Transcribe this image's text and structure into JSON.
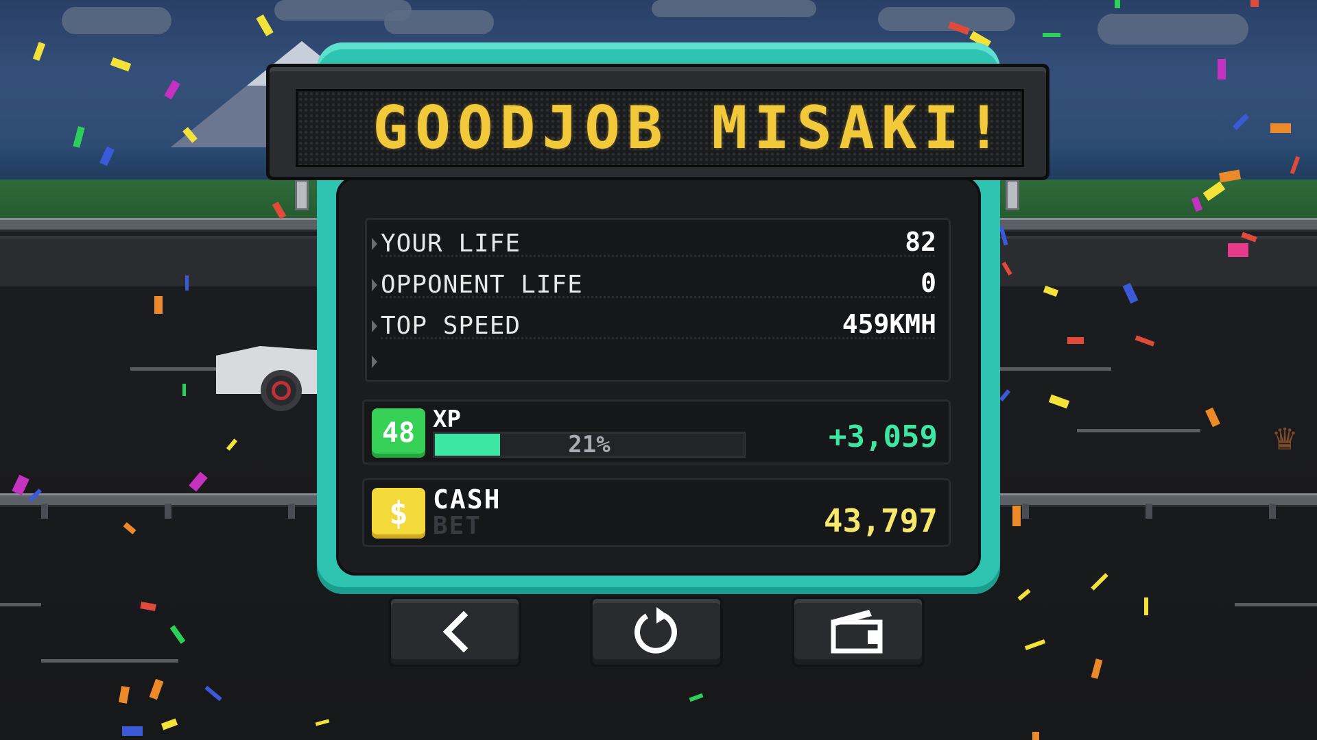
{
  "banner": {
    "text": "GOODJOB MISAKI!"
  },
  "stats": [
    {
      "label": "YOUR LIFE",
      "value": "82"
    },
    {
      "label": "OPPONENT LIFE",
      "value": "0"
    },
    {
      "label": "TOP SPEED",
      "value": "459KMH"
    },
    {
      "label": "",
      "value": ""
    }
  ],
  "xp": {
    "level": "48",
    "label": "XP",
    "progress_percent": 21,
    "progress_text": "21%",
    "gain": "+3,059"
  },
  "cash": {
    "icon": "$",
    "label": "CASH",
    "bet_label": "BET",
    "value": "43,797"
  },
  "buttons": {
    "back": "back-arrow-icon",
    "retry": "restart-icon",
    "replay": "camera-icon"
  },
  "colors": {
    "panel_frame": "#2fc4b2",
    "banner_text": "#f2c93a",
    "xp_green": "#3ee6a4",
    "level_badge": "#38d158",
    "cash_badge": "#f3da3a",
    "cash_value": "#f6e86a"
  }
}
